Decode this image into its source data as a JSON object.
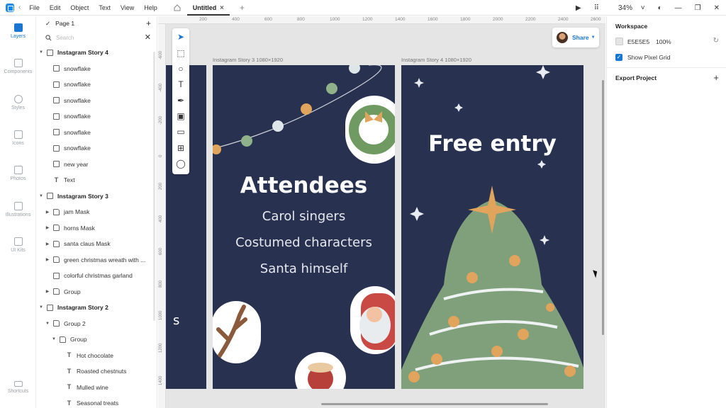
{
  "menu": [
    "File",
    "Edit",
    "Object",
    "Text",
    "View",
    "Help"
  ],
  "document": {
    "title": "Untitled"
  },
  "topbar": {
    "zoom": "34%"
  },
  "rail": [
    {
      "label": "Layers",
      "icon": "layers-icon"
    },
    {
      "label": "Components",
      "icon": "components-icon"
    },
    {
      "label": "Styles",
      "icon": "styles-icon"
    },
    {
      "label": "Icons",
      "icon": "icons-icon"
    },
    {
      "label": "Photos",
      "icon": "photos-icon"
    },
    {
      "label": "Illustrations",
      "icon": "illustrations-icon"
    },
    {
      "label": "UI Kits",
      "icon": "ui-kits-icon"
    },
    {
      "label": "Shortcuts",
      "icon": "keyboard-icon"
    }
  ],
  "layers_panel": {
    "page": "Page 1",
    "search_placeholder": "Search",
    "items": [
      {
        "label": "Instagram Story 4",
        "type": "page",
        "indent": 0,
        "section": true
      },
      {
        "label": "snowflake",
        "type": "image",
        "indent": 1
      },
      {
        "label": "snowflake",
        "type": "image",
        "indent": 1
      },
      {
        "label": "snowflake",
        "type": "image",
        "indent": 1
      },
      {
        "label": "snowflake",
        "type": "image",
        "indent": 1
      },
      {
        "label": "snowflake",
        "type": "image",
        "indent": 1
      },
      {
        "label": "snowflake",
        "type": "image",
        "indent": 1
      },
      {
        "label": "new year",
        "type": "image",
        "indent": 1
      },
      {
        "label": "Text",
        "type": "text",
        "indent": 1
      },
      {
        "label": "Instagram Story 3",
        "type": "page",
        "indent": 0,
        "section": true
      },
      {
        "label": "jam Mask",
        "type": "folder",
        "indent": 1
      },
      {
        "label": "horns Mask",
        "type": "folder",
        "indent": 1
      },
      {
        "label": "santa claus Mask",
        "type": "folder",
        "indent": 1
      },
      {
        "label": "green christmas wreath with ...",
        "type": "folder",
        "indent": 1
      },
      {
        "label": "colorful christmas garland",
        "type": "image",
        "indent": 1
      },
      {
        "label": "Group",
        "type": "folder",
        "indent": 1
      },
      {
        "label": "Instagram Story 2",
        "type": "page",
        "indent": 0,
        "section": true
      },
      {
        "label": "Group 2",
        "type": "folder",
        "indent": 1,
        "open": true
      },
      {
        "label": "Group",
        "type": "folder",
        "indent": 2,
        "open": true
      },
      {
        "label": "Hot chocolate",
        "type": "text",
        "indent": 3
      },
      {
        "label": "Roasted chestnuts",
        "type": "text",
        "indent": 3
      },
      {
        "label": "Mulled wine",
        "type": "text",
        "indent": 3
      },
      {
        "label": "Seasonal treats",
        "type": "text",
        "indent": 3
      }
    ]
  },
  "canvas": {
    "ruler_top": [
      "200",
      "400",
      "600",
      "800",
      "1000",
      "1200",
      "1400",
      "1600",
      "1800",
      "2000",
      "2200",
      "2400",
      "2600"
    ],
    "ruler_left": [
      "-600",
      "-400",
      "-200",
      "0",
      "200",
      "400",
      "600",
      "800",
      "1000",
      "1200",
      "1400"
    ],
    "frame3_label": "Instagram Story 3  1080×1920",
    "frame4_label": "Instagram Story 4  1080×1920",
    "frame2_partial_text": "s",
    "frame3": {
      "title": "Attendees",
      "lines": [
        "Carol singers",
        "Costumed characters",
        "Santa himself"
      ]
    },
    "frame4": {
      "title": "Free entry"
    }
  },
  "share": {
    "label": "Share"
  },
  "right_panel": {
    "workspace_title": "Workspace",
    "bg_hex": "E5E5E5",
    "bg_opacity": "100%",
    "show_pixel_grid": "Show Pixel Grid",
    "export_title": "Export Project"
  },
  "colors": {
    "frame_bg": "#283250",
    "accent": "#1976d2",
    "canvas_bg": "#e5e5e5",
    "tree_green": "#7fa07b",
    "ornament_orange": "#e0a45c"
  }
}
